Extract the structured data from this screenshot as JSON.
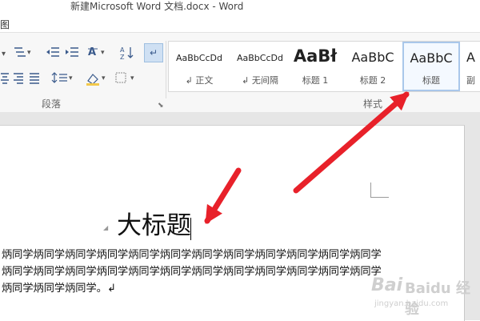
{
  "window": {
    "title": "新建Microsoft Word 文档.docx - Word",
    "tab_partial": "图"
  },
  "ribbon": {
    "paragraph_group_label": "段落",
    "styles_group_label": "样式",
    "styles": [
      {
        "preview": "AaBbCcDd",
        "name": "↲ 正文",
        "font_size": 11,
        "bold": false
      },
      {
        "preview": "AaBbCcDd",
        "name": "↲ 无间隔",
        "font_size": 11,
        "bold": false
      },
      {
        "preview": "AaBł",
        "name": "标题 1",
        "font_size": 21,
        "bold": true
      },
      {
        "preview": "AaBbC",
        "name": "标题 2",
        "font_size": 17,
        "bold": false
      },
      {
        "preview": "AaBbC",
        "name": "标题",
        "font_size": 17,
        "bold": false,
        "selected": true
      },
      {
        "preview": "A",
        "name": "副",
        "font_size": 17,
        "bold": false
      }
    ]
  },
  "document": {
    "heading": "大标题",
    "paragraph_lines": [
      "炳同学炳同学炳同学炳同学炳同学炳同学炳同学炳同学炳同学炳同学炳同学炳同学",
      "炳同学炳同学炳同学炳同学炳同学炳同学炳同学炳同学炳同学炳同学炳同学炳同学",
      "炳同学炳同学炳同学。↲"
    ]
  },
  "watermark": {
    "brand": "Baidu 经验",
    "url": "jingyan.baidu.com"
  },
  "colors": {
    "arrow": "#e8212a",
    "selected_style_border": "#a9c7ea"
  }
}
